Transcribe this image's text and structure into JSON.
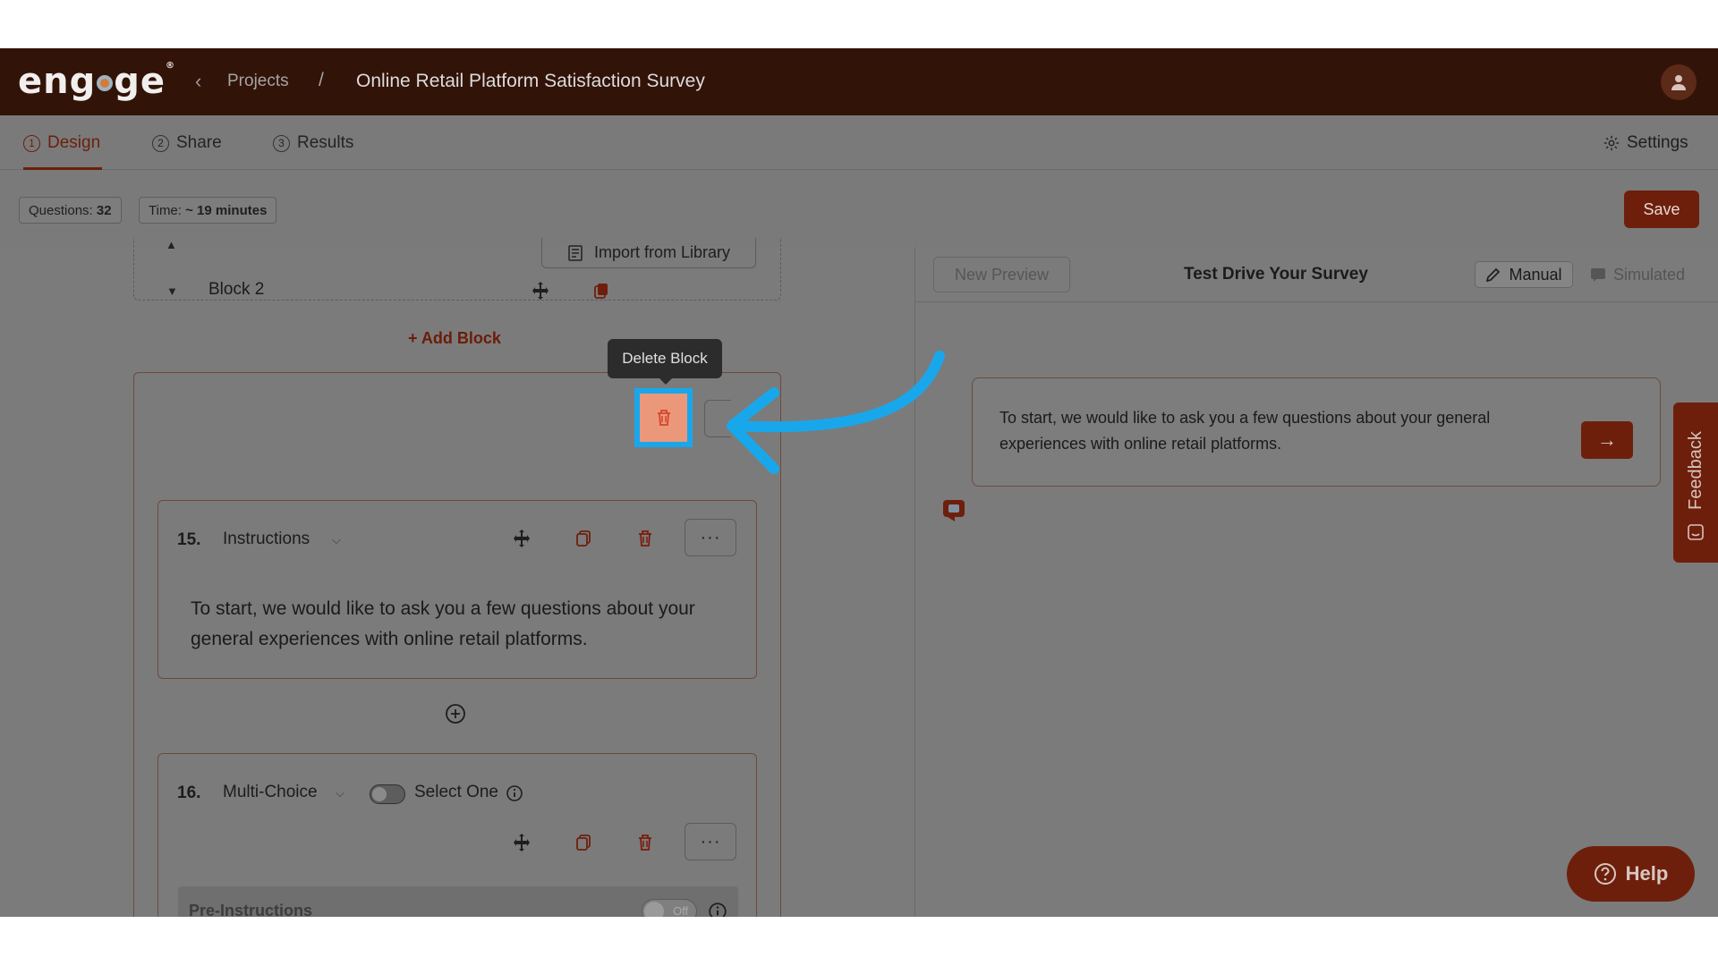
{
  "header": {
    "logo_text": "engage",
    "breadcrumb_back_icon": "chevron-left-icon",
    "breadcrumb_projects": "Projects",
    "breadcrumb_separator": "/",
    "title": "Online Retail Platform Satisfaction Survey"
  },
  "tabs": [
    {
      "num": "1",
      "label": "Design",
      "active": true
    },
    {
      "num": "2",
      "label": "Share"
    },
    {
      "num": "3",
      "label": "Results"
    }
  ],
  "settings_label": "Settings",
  "stats": {
    "questions_label": "Questions:",
    "questions_value": "32",
    "time_label": "Time:",
    "time_value": "~ 19 minutes"
  },
  "save_label": "Save",
  "editor": {
    "import_label": "Import from Library",
    "add_block_label": "+ Add Block",
    "block2_title": "Block 2",
    "tooltip": "Delete Block",
    "q15": {
      "num": "15.",
      "type": "Instructions",
      "text": "To start, we would like to ask you a few questions about your general experiences with online retail platforms."
    },
    "q16": {
      "num": "16.",
      "type": "Multi-Choice",
      "select_one_label": "Select One",
      "pre_instructions_label": "Pre-Instructions",
      "pre_toggle_value": "Off"
    },
    "more_label": "···"
  },
  "preview": {
    "new_preview_label": "New Preview",
    "title": "Test Drive Your Survey",
    "mode_manual": "Manual",
    "mode_simulated": "Simulated",
    "message": "To start, we would like to ask you a few questions about your general experiences with online retail platforms.",
    "next_icon": "arrow-right-icon"
  },
  "feedback_label": "Feedback",
  "help_label": "Help",
  "colors": {
    "brand": "#6e1f0c",
    "header_bg": "#321307",
    "highlight": "#19a7ec"
  }
}
